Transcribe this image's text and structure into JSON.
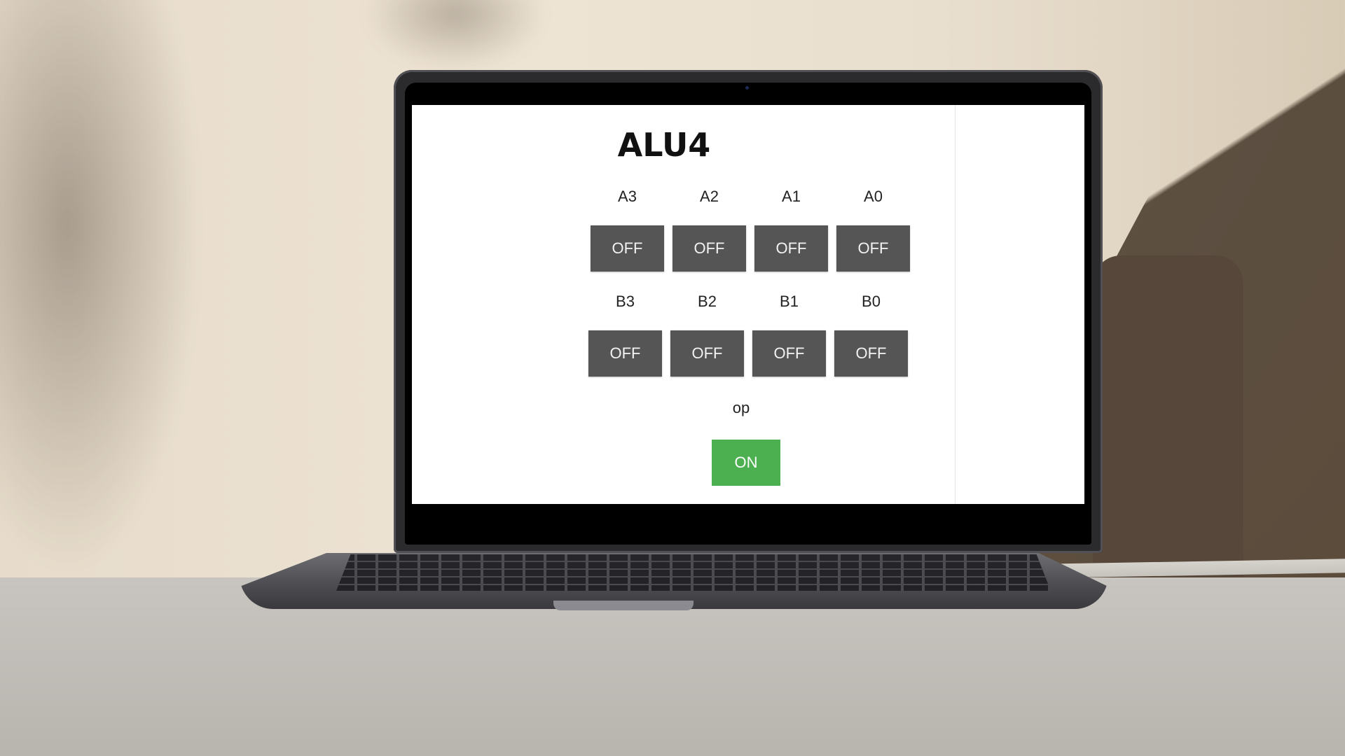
{
  "app": {
    "title": "ALU4"
  },
  "a_bits": [
    {
      "label": "A3",
      "state": "OFF"
    },
    {
      "label": "A2",
      "state": "OFF"
    },
    {
      "label": "A1",
      "state": "OFF"
    },
    {
      "label": "A0",
      "state": "OFF"
    }
  ],
  "b_bits": [
    {
      "label": "B3",
      "state": "OFF"
    },
    {
      "label": "B2",
      "state": "OFF"
    },
    {
      "label": "B1",
      "state": "OFF"
    },
    {
      "label": "B0",
      "state": "OFF"
    }
  ],
  "op": {
    "label": "op",
    "state": "ON"
  },
  "colors": {
    "off_button": "#555555",
    "on_button": "#4caf50",
    "screen_background": "#ffffff"
  }
}
